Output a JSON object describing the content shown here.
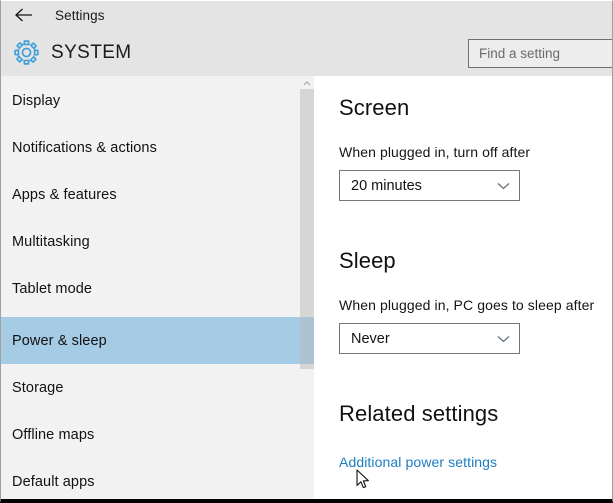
{
  "window": {
    "app_title": "Settings",
    "back_icon": "back-arrow-icon"
  },
  "header": {
    "icon": "gear-icon",
    "page_title": "SYSTEM",
    "accent_color": "#3f9fd8"
  },
  "search": {
    "placeholder": "Find a setting",
    "value": ""
  },
  "sidebar": {
    "scroll_up_icon": "chevron-up-icon",
    "selected_index": 5,
    "selected_color": "#a5cbe5",
    "items": [
      {
        "label": "Display"
      },
      {
        "label": "Notifications & actions"
      },
      {
        "label": "Apps & features"
      },
      {
        "label": "Multitasking"
      },
      {
        "label": "Tablet mode"
      },
      {
        "label": "Power & sleep"
      },
      {
        "label": "Storage"
      },
      {
        "label": "Offline maps"
      },
      {
        "label": "Default apps"
      }
    ]
  },
  "content": {
    "screen": {
      "heading": "Screen",
      "label": "When plugged in, turn off after",
      "value": "20 minutes",
      "chevron_icon": "chevron-down-icon"
    },
    "sleep": {
      "heading": "Sleep",
      "label": "When plugged in, PC goes to sleep after",
      "value": "Never",
      "chevron_icon": "chevron-down-icon"
    },
    "related": {
      "heading": "Related settings",
      "link": "Additional power settings",
      "link_color": "#1b7ec2"
    }
  },
  "cursor": {
    "icon": "mouse-pointer-icon"
  }
}
